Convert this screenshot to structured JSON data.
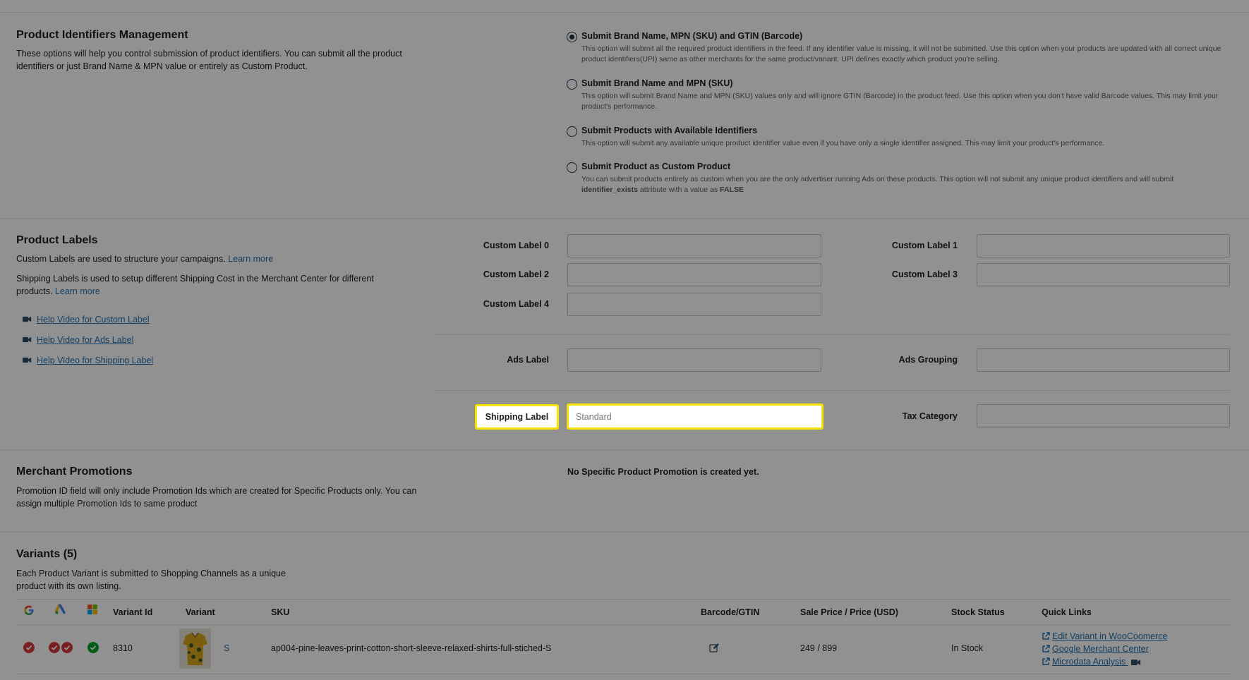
{
  "identifiers": {
    "title": "Product Identifiers Management",
    "description": "These options will help you control submission of product identifiers. You can submit all the product identifiers or just Brand Name & MPN value or entirely as Custom Product.",
    "options": [
      {
        "label": "Submit Brand Name, MPN (SKU) and GTIN (Barcode)",
        "checked": true,
        "desc": "This option will submit all the required product identifiers in the feed. If any identifier value is missing, it will not be submitted. Use this option when your products are updated with all correct unique product identifiers(UPI) same as other merchants for the same product/variant. UPI defines exactly which product you're selling."
      },
      {
        "label": "Submit Brand Name and MPN (SKU)",
        "checked": false,
        "desc": "This option will submit Brand Name and MPN (SKU) values only and will ignore GTIN (Barcode) in the product feed. Use this option when you don't have valid Barcode values. This may limit your product's performance."
      },
      {
        "label": "Submit Products with Available Identifiers",
        "checked": false,
        "desc": "This option will submit any available unique product identifier value even if you have only a single identifier assigned. This may limit your product's performance."
      },
      {
        "label": "Submit Product as Custom Product",
        "checked": false,
        "desc_part1": "You can submit products entirely as custom when you are the only advertiser running Ads on these products. This option will not submit any unique product identifiers and will submit ",
        "desc_bold1": "identifier_exists",
        "desc_part2": " attribute with a value as ",
        "desc_bold2": "FALSE"
      }
    ]
  },
  "labels": {
    "title": "Product Labels",
    "desc1": "Custom Labels are used to structure your campaigns.",
    "learn_more": "Learn more",
    "desc2": "Shipping Labels is used to setup different Shipping Cost in the Merchant Center for different products.",
    "help_videos": [
      "Help Video for Custom Label",
      "Help Video for Ads Label",
      "Help Video for Shipping Label"
    ],
    "fields": {
      "custom_label_0": "Custom Label 0",
      "custom_label_1": "Custom Label 1",
      "custom_label_2": "Custom Label 2",
      "custom_label_3": "Custom Label 3",
      "custom_label_4": "Custom Label 4",
      "ads_label": "Ads Label",
      "ads_grouping": "Ads Grouping",
      "shipping_label": "Shipping Label",
      "shipping_placeholder": "Standard",
      "tax_category": "Tax Category"
    }
  },
  "promotions": {
    "title": "Merchant Promotions",
    "description": "Promotion ID field will only include Promotion Ids which are created for Specific Products only. You can assign multiple Promotion Ids to same product",
    "empty_message": "No Specific Product Promotion is created yet."
  },
  "variants": {
    "title": "Variants (5)",
    "description": "Each Product Variant is submitted to Shopping Channels as a unique product with its own listing.",
    "columns": [
      "Variant Id",
      "Variant",
      "SKU",
      "Barcode/GTIN",
      "Sale Price / Price (USD)",
      "Stock Status",
      "Quick Links"
    ],
    "channel_icons": [
      "google-icon",
      "google-ads-icon",
      "microsoft-icon"
    ],
    "rows": [
      {
        "variant_id": "8310",
        "variant": "S",
        "sku": "ap004-pine-leaves-print-cotton-short-sleeve-relaxed-shirts-full-stiched-S",
        "price": "249 / 899",
        "stock": "In Stock",
        "links": [
          "Edit Variant in WooCoomerce",
          "Google Merchant Center",
          "Microdata Analysis"
        ]
      }
    ]
  },
  "colors": {
    "accent": "#2271b1",
    "radio": "#1d3750",
    "error": "#d63638",
    "success": "#00a32a",
    "highlight": "#f7e300",
    "overlay": "rgba(0,0,0,0.43)"
  }
}
